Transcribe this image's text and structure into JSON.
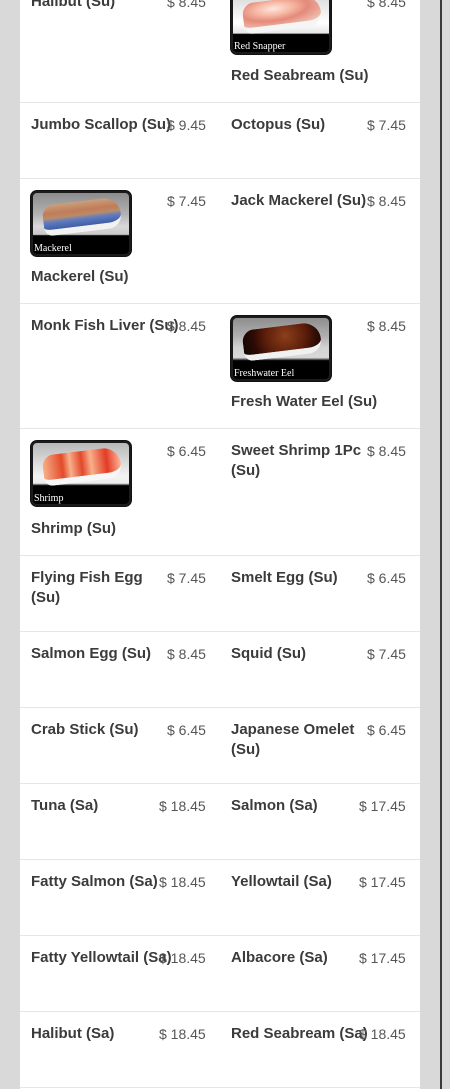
{
  "menu": {
    "items": [
      {
        "name": "Halibut (Su)",
        "price": "$ 8.45"
      },
      {
        "name": "Red Seabream (Su)",
        "price": "$ 8.45",
        "image_caption": "Red Snapper"
      },
      {
        "name": "Jumbo Scallop (Su)",
        "price": "$ 9.45"
      },
      {
        "name": "Octopus (Su)",
        "price": "$ 7.45"
      },
      {
        "name": "Mackerel (Su)",
        "price": "$ 7.45",
        "image_caption": "Mackerel"
      },
      {
        "name": "Jack Mackerel (Su)",
        "price": "$ 8.45"
      },
      {
        "name": "Monk Fish Liver (Su)",
        "price": "$ 8.45"
      },
      {
        "name": "Fresh Water Eel (Su)",
        "price": "$ 8.45",
        "image_caption": "Freshwater Eel"
      },
      {
        "name": "Shrimp (Su)",
        "price": "$ 6.45",
        "image_caption": "Shrimp"
      },
      {
        "name": "Sweet Shrimp 1Pc (Su)",
        "price": "$ 8.45"
      },
      {
        "name": "Flying Fish Egg (Su)",
        "price": "$ 7.45"
      },
      {
        "name": "Smelt Egg (Su)",
        "price": "$ 6.45"
      },
      {
        "name": "Salmon Egg (Su)",
        "price": "$ 8.45"
      },
      {
        "name": "Squid (Su)",
        "price": "$ 7.45"
      },
      {
        "name": "Crab Stick (Su)",
        "price": "$ 6.45"
      },
      {
        "name": "Japanese Omelet (Su)",
        "price": "$ 6.45"
      },
      {
        "name": "Tuna (Sa)",
        "price": "$ 18.45"
      },
      {
        "name": "Salmon (Sa)",
        "price": "$ 17.45"
      },
      {
        "name": "Fatty Salmon (Sa)",
        "price": "$ 18.45"
      },
      {
        "name": "Yellowtail (Sa)",
        "price": "$ 17.45"
      },
      {
        "name": "Fatty Yellowtail (Sa)",
        "price": "$ 18.45"
      },
      {
        "name": "Albacore (Sa)",
        "price": "$ 17.45"
      },
      {
        "name": "Halibut (Sa)",
        "price": "$ 18.45"
      },
      {
        "name": "Red Seabream (Sa)",
        "price": "$ 18.45"
      }
    ]
  }
}
